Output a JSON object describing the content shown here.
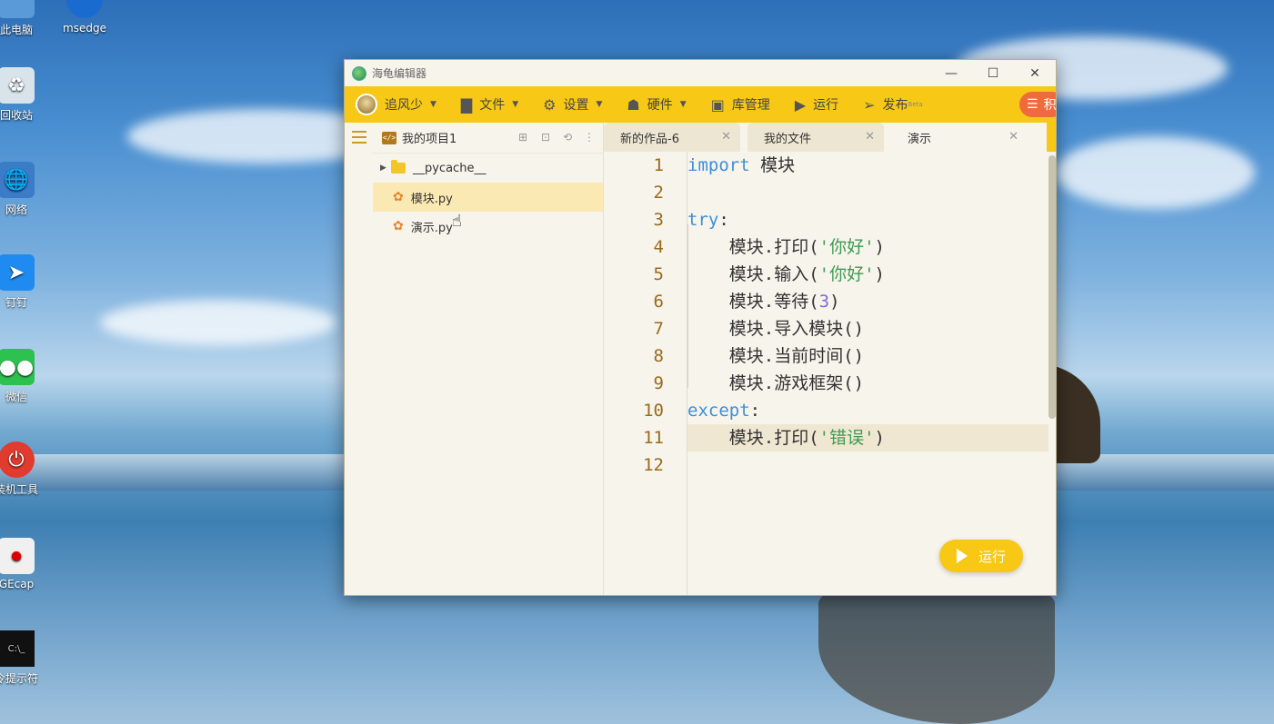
{
  "window": {
    "title": "海龟编辑器",
    "controls": {
      "minimize": "—",
      "maximize": "☐",
      "close": "✕"
    }
  },
  "toolbar": {
    "user": "追风少",
    "file": "文件",
    "settings": "设置",
    "hardware": "硬件",
    "library": "库管理",
    "run": "运行",
    "publish": "发布",
    "publish_sup": "Beta",
    "extra": "积"
  },
  "project": {
    "name": "我的项目1",
    "items": [
      {
        "label": "__pycache__",
        "type": "folder"
      },
      {
        "label": "模块.py",
        "type": "py"
      },
      {
        "label": "演示.py",
        "type": "py"
      }
    ]
  },
  "tabs": [
    {
      "label": "新的作品-6"
    },
    {
      "label": "我的文件"
    },
    {
      "label": "演示"
    }
  ],
  "code_lines": [
    {
      "n": "1"
    },
    {
      "n": "2"
    },
    {
      "n": "3"
    },
    {
      "n": "4"
    },
    {
      "n": "5"
    },
    {
      "n": "6"
    },
    {
      "n": "7"
    },
    {
      "n": "8"
    },
    {
      "n": "9"
    },
    {
      "n": "10"
    },
    {
      "n": "11"
    },
    {
      "n": "12"
    }
  ],
  "code": {
    "l1_kw": "import",
    "l1_rest": " 模块",
    "l3_kw": "try",
    "l3_rest": ":",
    "l4_a": "    模块.打印(",
    "l4_s": "'你好'",
    "l4_b": ")",
    "l5_a": "    模块.输入(",
    "l5_s": "'你好'",
    "l5_b": ")",
    "l6_a": "    模块.等待(",
    "l6_n": "3",
    "l6_b": ")",
    "l7": "    模块.导入模块()",
    "l8": "    模块.当前时间()",
    "l9": "    模块.游戏框架()",
    "l10_kw": "except",
    "l10_rest": ":",
    "l11_a": "    模块.打印(",
    "l11_s": "'错误'",
    "l11_b": ")"
  },
  "run_button": "运行",
  "desktop": [
    {
      "label": "此电脑"
    },
    {
      "label": "msedge"
    },
    {
      "label": "回收站"
    },
    {
      "label": "网络"
    },
    {
      "label": "钉钉"
    },
    {
      "label": "微信"
    },
    {
      "label": "装机工具"
    },
    {
      "label": "GEcap"
    },
    {
      "label": "令提示符"
    }
  ]
}
